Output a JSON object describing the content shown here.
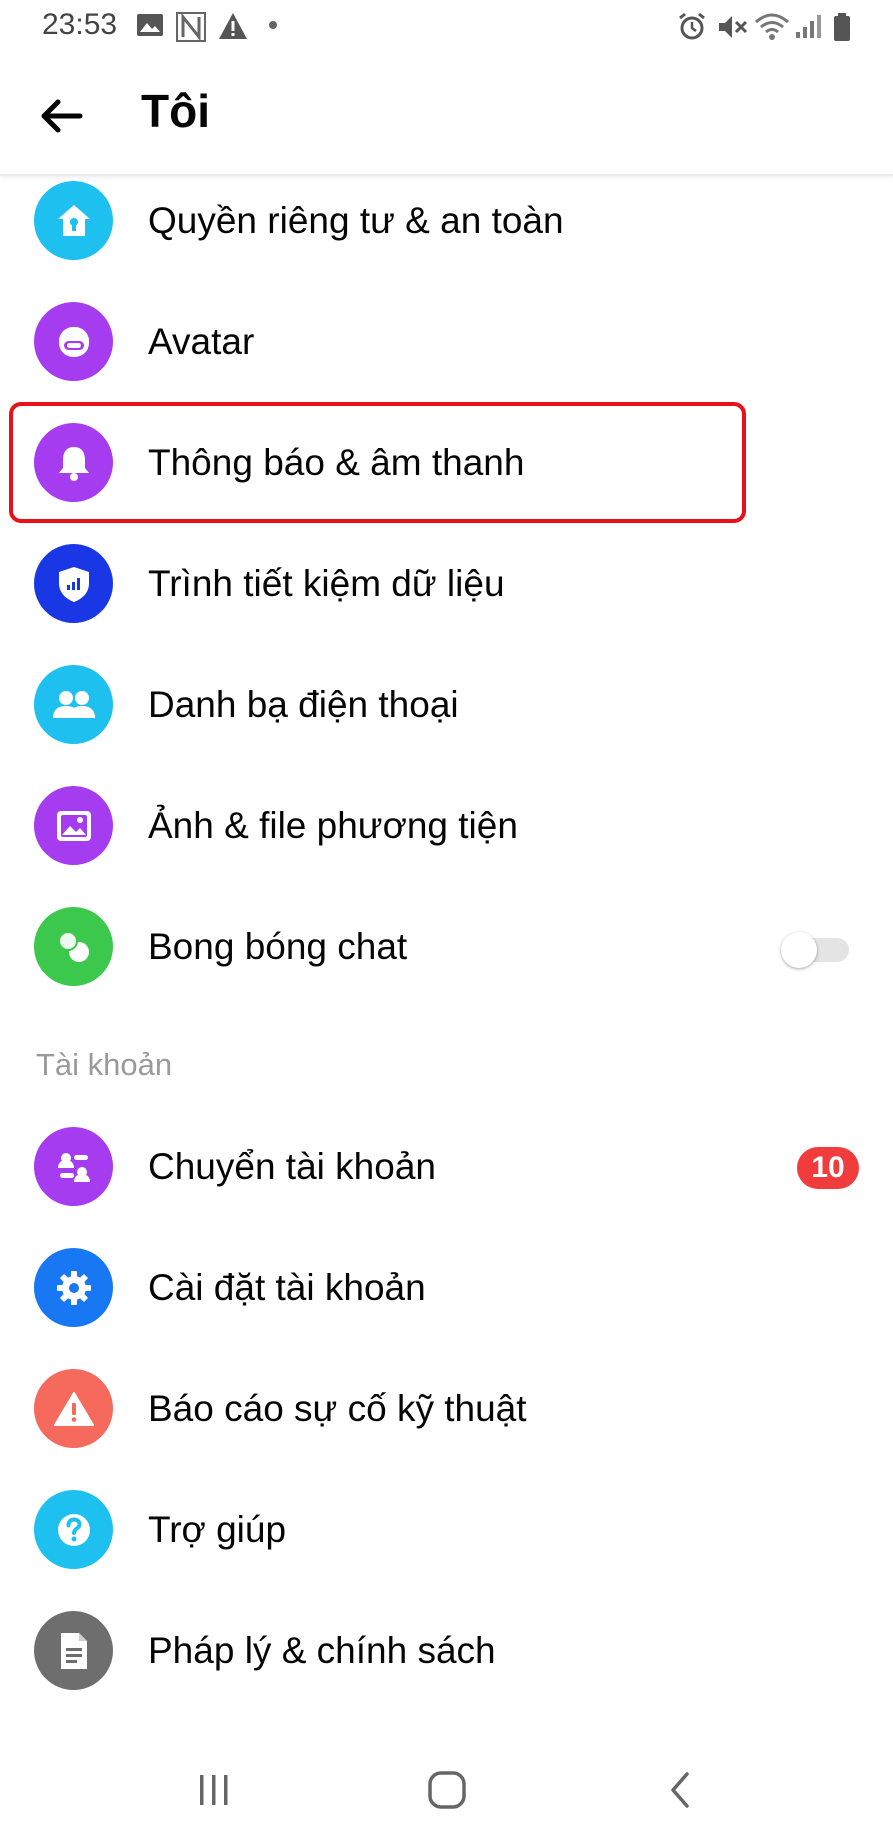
{
  "status_bar": {
    "time": "23:53"
  },
  "header": {
    "title": "Tôi"
  },
  "rows": [
    {
      "label": "Quyền riêng tư & an toàn",
      "icon": "privacy-home-icon",
      "color": "#1ec0f0"
    },
    {
      "label": "Avatar",
      "icon": "avatar-icon",
      "color": "#a63cf0"
    },
    {
      "label": "Thông báo & âm thanh",
      "icon": "bell-icon",
      "color": "#a63cf0"
    },
    {
      "label": "Trình tiết kiệm dữ liệu",
      "icon": "data-saver-shield-icon",
      "color": "#1a37e6"
    },
    {
      "label": "Danh bạ điện thoại",
      "icon": "contacts-people-icon",
      "color": "#1ec0f0"
    },
    {
      "label": "Ảnh & file phương tiện",
      "icon": "photo-icon",
      "color": "#a63cf0"
    },
    {
      "label": "Bong bóng chat",
      "icon": "chat-bubbles-icon",
      "color": "#3cc84c"
    }
  ],
  "account_section": {
    "title": "Tài khoản",
    "rows": [
      {
        "label": "Chuyển tài khoản",
        "icon": "switch-account-icon",
        "color": "#a63cf0"
      },
      {
        "label": "Cài đặt tài khoản",
        "icon": "gear-icon",
        "color": "#1877f2"
      },
      {
        "label": "Báo cáo sự cố kỹ thuật",
        "icon": "warning-icon",
        "color": "#f56a5c"
      },
      {
        "label": "Trợ giúp",
        "icon": "help-icon",
        "color": "#1ec0f0"
      },
      {
        "label": "Pháp lý & chính sách",
        "icon": "document-icon",
        "color": "#6e6e6e"
      }
    ]
  },
  "chat_bubbles_toggle": {
    "state": "off"
  },
  "switch_account_badge": "10",
  "highlight_color": "#e8101a"
}
